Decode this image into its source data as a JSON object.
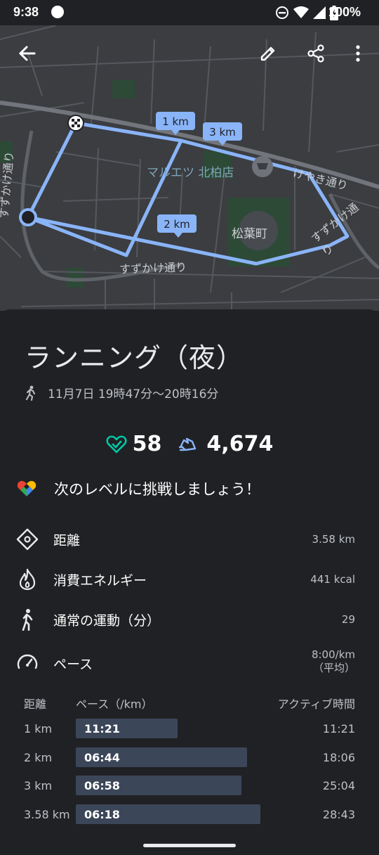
{
  "status_bar": {
    "time": "9:38",
    "battery_percent": "100%",
    "icons": [
      "notification-dot",
      "do-not-disturb-icon",
      "wifi-icon",
      "cell-signal-icon",
      "battery-charging-icon"
    ]
  },
  "map": {
    "labels": {
      "street_left": "すずかけ通り",
      "street_bottom": "すずかけ通り",
      "street_right": "すずかけ通り",
      "keyaki": "けやき通り",
      "store": "マルエツ 北柏店",
      "town": "松葉町"
    },
    "markers": [
      "1 km",
      "2 km",
      "3 km"
    ],
    "toolbar": {
      "back_icon": "arrow-back-icon",
      "edit_icon": "pencil-icon",
      "share_icon": "share-icon",
      "more_icon": "more-vert-icon"
    },
    "route_color": "#8ab4f8",
    "start_color": "#8ab4f8"
  },
  "activity": {
    "title": "ランニング（夜）",
    "date_range": "11月7日 19時47分～20時16分",
    "heart_points": "58",
    "steps": "4,674",
    "challenge": "次のレベルに挑戦しましょう！"
  },
  "stats": {
    "distance": {
      "label": "距離",
      "value": "3.58 km"
    },
    "energy": {
      "label": "消費エネルギー",
      "value": "441 kcal"
    },
    "move_minutes": {
      "label": "通常の運動（分）",
      "value": "29"
    },
    "pace": {
      "label": "ペース",
      "value_line1": "8:00/km",
      "value_line2": "（平均）"
    }
  },
  "splits": {
    "headers": {
      "distance": "距離",
      "pace": "ペース（/km）",
      "active_time": "アクティブ時間"
    },
    "rows": [
      {
        "distance": "1 km",
        "pace": "11:21",
        "active_time": "11:21",
        "bar_fraction": 0.54
      },
      {
        "distance": "2 km",
        "pace": "06:44",
        "active_time": "18:06",
        "bar_fraction": 0.91
      },
      {
        "distance": "3 km",
        "pace": "06:58",
        "active_time": "25:04",
        "bar_fraction": 0.88
      },
      {
        "distance": "3.58 km",
        "pace": "06:18",
        "active_time": "28:43",
        "bar_fraction": 0.98
      }
    ]
  },
  "colors": {
    "background": "#202124",
    "heart": "#00c9a7",
    "steps": "#8ab4f8",
    "bar": "#3c4659"
  }
}
